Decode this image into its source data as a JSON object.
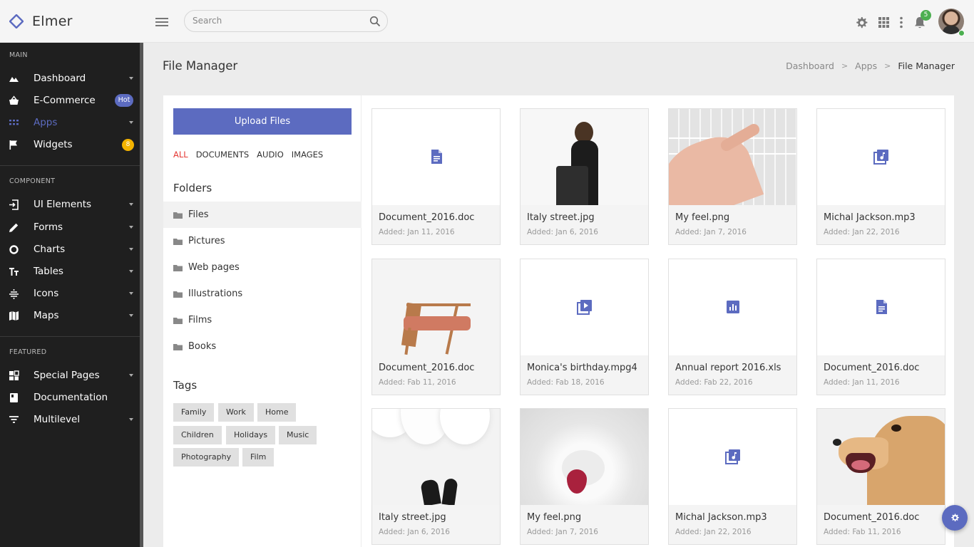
{
  "app": {
    "name": "Elmer"
  },
  "header": {
    "search_placeholder": "Search",
    "notification_count": "5"
  },
  "sidebar": {
    "sections": [
      "MAIN",
      "COMPONENT",
      "FEATURED"
    ],
    "main_items": [
      {
        "label": "Dashboard",
        "icon": "chart-area-icon"
      },
      {
        "label": "E-Commerce",
        "icon": "basket-icon",
        "badge": "Hot"
      },
      {
        "label": "Apps",
        "icon": "grid-dots-icon",
        "active": true
      },
      {
        "label": "Widgets",
        "icon": "flag-icon",
        "badge": "8"
      }
    ],
    "component_items": [
      {
        "label": "UI Elements",
        "icon": "login-icon"
      },
      {
        "label": "Forms",
        "icon": "pencil-icon"
      },
      {
        "label": "Charts",
        "icon": "donut-icon"
      },
      {
        "label": "Tables",
        "icon": "text-format-icon"
      },
      {
        "label": "Icons",
        "icon": "sparkle-icon"
      },
      {
        "label": "Maps",
        "icon": "map-icon"
      }
    ],
    "featured_items": [
      {
        "label": "Special Pages",
        "icon": "pages-icon"
      },
      {
        "label": "Documentation",
        "icon": "book-icon"
      },
      {
        "label": "Multilevel",
        "icon": "filter-icon"
      }
    ]
  },
  "page": {
    "title": "File Manager",
    "breadcrumb": [
      "Dashboard",
      "Apps",
      "File Manager"
    ]
  },
  "file_manager": {
    "upload_label": "Upload Files",
    "filters": [
      "ALL",
      "DOCUMENTS",
      "AUDIO",
      "IMAGES"
    ],
    "active_filter": "ALL",
    "folders_heading": "Folders",
    "folders": [
      "Files",
      "Pictures",
      "Web pages",
      "Illustrations",
      "Films",
      "Books"
    ],
    "active_folder": "Files",
    "tags_heading": "Tags",
    "tags": [
      "Family",
      "Work",
      "Home",
      "Children",
      "Holidays",
      "Music",
      "Photography",
      "Film"
    ],
    "accent_color": "#5c6bc0",
    "files": [
      {
        "name": "Document_2016.doc",
        "added": "Added: Jan 11, 2016",
        "thumb": "doc-icon"
      },
      {
        "name": "Italy street.jpg",
        "added": "Added: Jan 6, 2016",
        "thumb": "woman-photo"
      },
      {
        "name": "My feel.png",
        "added": "Added: Jan 7, 2016",
        "thumb": "keyboard-photo"
      },
      {
        "name": "Michal Jackson.mp3",
        "added": "Added: Jan 22, 2016",
        "thumb": "music-icon"
      },
      {
        "name": "Document_2016.doc",
        "added": "Added: Fab 11, 2016",
        "thumb": "chair-photo"
      },
      {
        "name": "Monica's birthday.mpg4",
        "added": "Added: Fab 18, 2016",
        "thumb": "video-icon"
      },
      {
        "name": "Annual report 2016.xls",
        "added": "Added: Fab 22, 2016",
        "thumb": "chart-icon"
      },
      {
        "name": "Document_2016.doc",
        "added": "Added: Jan 11, 2016",
        "thumb": "doc-icon"
      },
      {
        "name": "Italy street.jpg",
        "added": "Added: Jan 6, 2016",
        "thumb": "balloons-photo"
      },
      {
        "name": "My feel.png",
        "added": "Added: Jan 7, 2016",
        "thumb": "strawberry-photo"
      },
      {
        "name": "Michal Jackson.mp3",
        "added": "Added: Jan 22, 2016",
        "thumb": "music-icon"
      },
      {
        "name": "Document_2016.doc",
        "added": "Added: Fab 11, 2016",
        "thumb": "dog-photo"
      }
    ]
  }
}
